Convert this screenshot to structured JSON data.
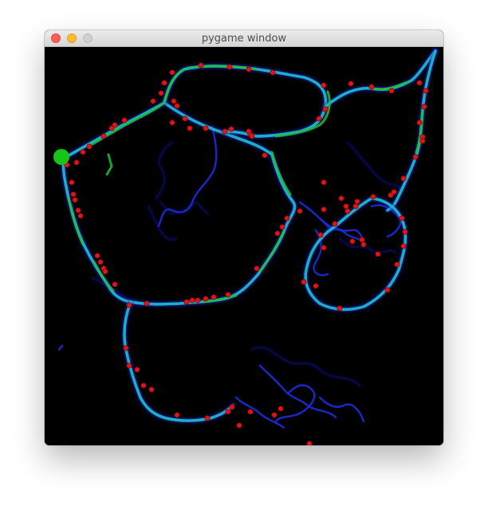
{
  "window": {
    "title": "pygame window",
    "buttons": [
      "close",
      "minimize",
      "maximize"
    ]
  },
  "canvas": {
    "background": "#000000",
    "trail_colors": {
      "cyan": "#1fb7c9",
      "green": "#22c032",
      "blue": "#1c2bd8",
      "dark_blue": "#0b0f7a"
    },
    "node_color": "#e11515",
    "agent_color": "#18c418"
  }
}
